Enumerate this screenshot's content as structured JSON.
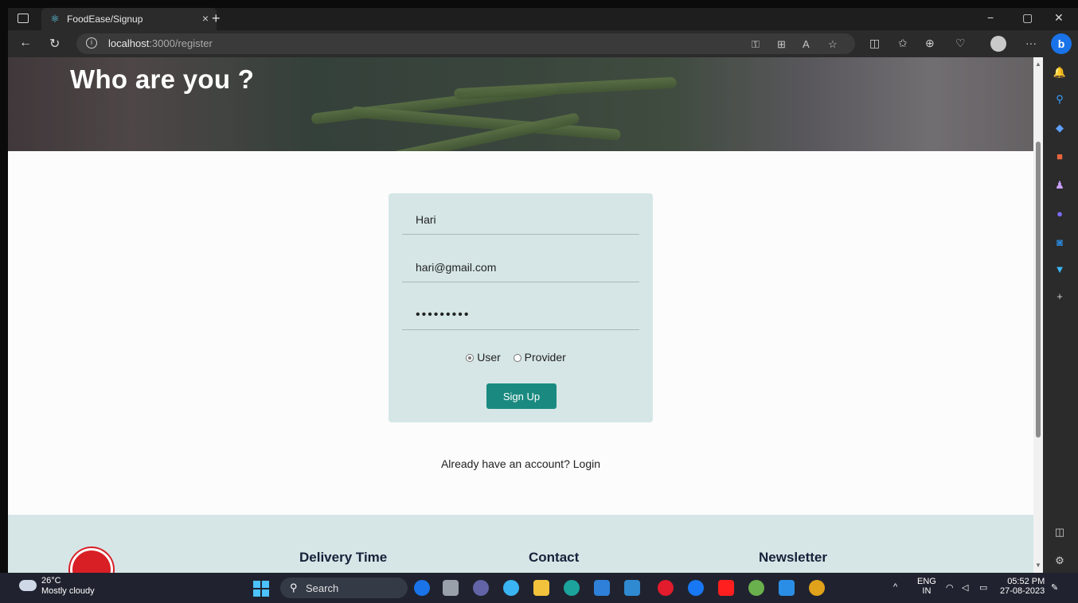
{
  "browser": {
    "tab_title": "FoodEase/Signup",
    "tab_close": "×",
    "new_tab": "+",
    "url_host": "localhost",
    "url_rest": ":3000/register",
    "window_minimize": "−",
    "window_restore": "▢",
    "window_close": "✕"
  },
  "page": {
    "hero_title": "Who are you ?",
    "form": {
      "name_value": "Hari",
      "email_value": "hari@gmail.com",
      "password_value": "•••••••••",
      "role_options": [
        "User",
        "Provider"
      ],
      "selected_role": "User",
      "submit_label": "Sign Up"
    },
    "login_prompt": "Already have an account? Login",
    "footer": {
      "col1_heading": "Delivery Time",
      "col2_heading": "Contact",
      "col3_heading": "Newsletter"
    }
  },
  "taskbar": {
    "temperature": "26°C",
    "weather": "Mostly cloudy",
    "search_label": "Search",
    "lang_top": "ENG",
    "lang_bottom": "IN",
    "time": "05:52 PM",
    "date": "27-08-2023"
  },
  "colors": {
    "accent": "#1a8a80",
    "card_bg": "#d6e6e6",
    "footer_heading": "#16213a"
  }
}
